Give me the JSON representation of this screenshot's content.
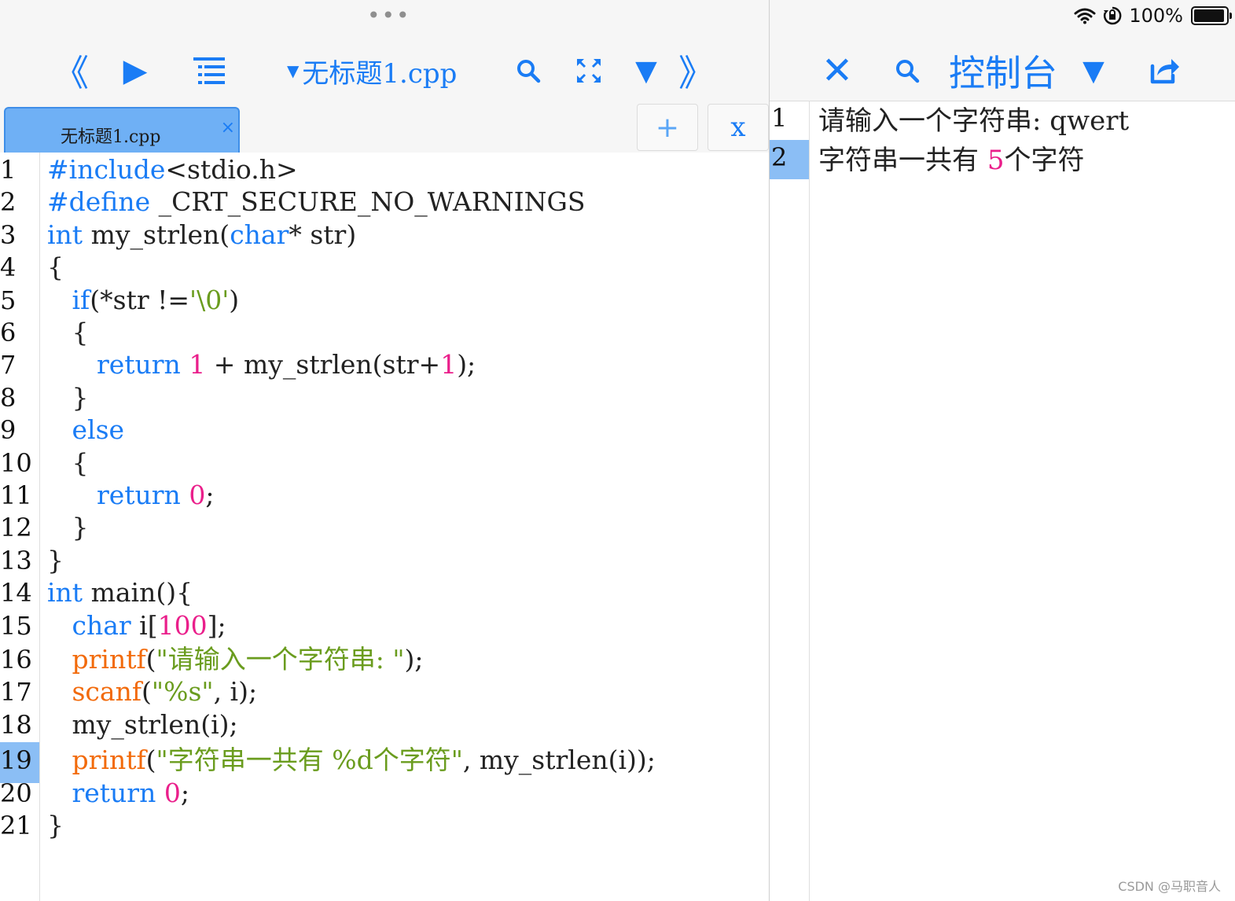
{
  "editor": {
    "toolbar": {
      "menu_dots": "•••",
      "back_glyph": "《",
      "run_glyph": "▶",
      "caret_glyph": "▼",
      "file_name": "无标题1.cpp",
      "down_glyph": "▼",
      "forward_glyph": "》"
    },
    "tab": {
      "label": "无标题1.cpp",
      "close_glyph": "×"
    },
    "add_tab_glyph": "+",
    "close_tab_glyph": "x",
    "highlighted_line": "19",
    "lines": [
      {
        "no": "1",
        "tokens": [
          {
            "t": "#include",
            "c": "k"
          },
          {
            "t": "<stdio.h>",
            "c": ""
          }
        ]
      },
      {
        "no": "2",
        "tokens": [
          {
            "t": "#define",
            "c": "k"
          },
          {
            "t": " _CRT_SECURE_NO_WARNINGS",
            "c": ""
          }
        ]
      },
      {
        "no": "3",
        "tokens": [
          {
            "t": "int",
            "c": "k"
          },
          {
            "t": " my_strlen(",
            "c": ""
          },
          {
            "t": "char",
            "c": "k"
          },
          {
            "t": "* str)",
            "c": ""
          }
        ]
      },
      {
        "no": "4",
        "tokens": [
          {
            "t": "{",
            "c": ""
          }
        ]
      },
      {
        "no": "5",
        "tokens": [
          {
            "t": "   ",
            "c": ""
          },
          {
            "t": "if",
            "c": "k"
          },
          {
            "t": "(*str !=",
            "c": ""
          },
          {
            "t": "'\\0'",
            "c": "s"
          },
          {
            "t": ")",
            "c": ""
          }
        ]
      },
      {
        "no": "6",
        "tokens": [
          {
            "t": "   {",
            "c": ""
          }
        ]
      },
      {
        "no": "7",
        "tokens": [
          {
            "t": "      ",
            "c": ""
          },
          {
            "t": "return",
            "c": "k"
          },
          {
            "t": " ",
            "c": ""
          },
          {
            "t": "1",
            "c": "n"
          },
          {
            "t": " + my_strlen(str+",
            "c": ""
          },
          {
            "t": "1",
            "c": "n"
          },
          {
            "t": ");",
            "c": ""
          }
        ]
      },
      {
        "no": "8",
        "tokens": [
          {
            "t": "   }",
            "c": ""
          }
        ]
      },
      {
        "no": "9",
        "tokens": [
          {
            "t": "   ",
            "c": ""
          },
          {
            "t": "else",
            "c": "k"
          }
        ]
      },
      {
        "no": "10",
        "tokens": [
          {
            "t": "   {",
            "c": ""
          }
        ]
      },
      {
        "no": "11",
        "tokens": [
          {
            "t": "      ",
            "c": ""
          },
          {
            "t": "return",
            "c": "k"
          },
          {
            "t": " ",
            "c": ""
          },
          {
            "t": "0",
            "c": "n"
          },
          {
            "t": ";",
            "c": ""
          }
        ]
      },
      {
        "no": "12",
        "tokens": [
          {
            "t": "   }",
            "c": ""
          }
        ]
      },
      {
        "no": "13",
        "tokens": [
          {
            "t": "}",
            "c": ""
          }
        ]
      },
      {
        "no": "14",
        "tokens": [
          {
            "t": "int",
            "c": "k"
          },
          {
            "t": " main(){",
            "c": ""
          }
        ]
      },
      {
        "no": "15",
        "tokens": [
          {
            "t": "   ",
            "c": ""
          },
          {
            "t": "char",
            "c": "k"
          },
          {
            "t": " i[",
            "c": ""
          },
          {
            "t": "100",
            "c": "n"
          },
          {
            "t": "];",
            "c": ""
          }
        ]
      },
      {
        "no": "16",
        "tokens": [
          {
            "t": "   ",
            "c": ""
          },
          {
            "t": "printf",
            "c": "f"
          },
          {
            "t": "(",
            "c": ""
          },
          {
            "t": "\"请输入一个字符串: \"",
            "c": "s"
          },
          {
            "t": ");",
            "c": ""
          }
        ]
      },
      {
        "no": "17",
        "tokens": [
          {
            "t": "   ",
            "c": ""
          },
          {
            "t": "scanf",
            "c": "f"
          },
          {
            "t": "(",
            "c": ""
          },
          {
            "t": "\"%s\"",
            "c": "s"
          },
          {
            "t": ", i);",
            "c": ""
          }
        ]
      },
      {
        "no": "18",
        "tokens": [
          {
            "t": "   my_strlen(i);",
            "c": ""
          }
        ]
      },
      {
        "no": "19",
        "tokens": [
          {
            "t": "   ",
            "c": ""
          },
          {
            "t": "printf",
            "c": "f"
          },
          {
            "t": "(",
            "c": ""
          },
          {
            "t": "\"字符串一共有 %d个字符\"",
            "c": "s"
          },
          {
            "t": ", my_strlen(i));",
            "c": ""
          }
        ]
      },
      {
        "no": "20",
        "tokens": [
          {
            "t": "   ",
            "c": ""
          },
          {
            "t": "return",
            "c": "k"
          },
          {
            "t": " ",
            "c": ""
          },
          {
            "t": "0",
            "c": "n"
          },
          {
            "t": ";",
            "c": ""
          }
        ]
      },
      {
        "no": "21",
        "tokens": [
          {
            "t": "}",
            "c": ""
          }
        ]
      }
    ]
  },
  "console": {
    "status_bar": {
      "battery_text": "100%"
    },
    "toolbar": {
      "close_glyph": "✕",
      "title": "控制台",
      "down_glyph": "▼"
    },
    "highlighted_line": "2",
    "lines": [
      {
        "no": "1",
        "tokens": [
          {
            "t": "请输入一个字符串: qwert",
            "c": ""
          }
        ]
      },
      {
        "no": "2",
        "tokens": [
          {
            "t": "字符串一共有 ",
            "c": ""
          },
          {
            "t": "5",
            "c": "n"
          },
          {
            "t": "个字符",
            "c": ""
          }
        ]
      }
    ]
  },
  "watermark": "CSDN @马职音人",
  "colors": {
    "accent": "#1a7cf5",
    "number": "#ea1f8b",
    "string": "#6a9c1e",
    "function": "#f26a0a",
    "highlight": "#8bbef5"
  },
  "icons": [
    "menu-dots-icon",
    "back-icon",
    "run-icon",
    "outline-list-icon",
    "search-icon",
    "fullscreen-icon",
    "dropdown-icon",
    "forward-icon",
    "close-icon",
    "share-icon",
    "wifi-icon",
    "orientation-lock-icon",
    "battery-icon"
  ]
}
